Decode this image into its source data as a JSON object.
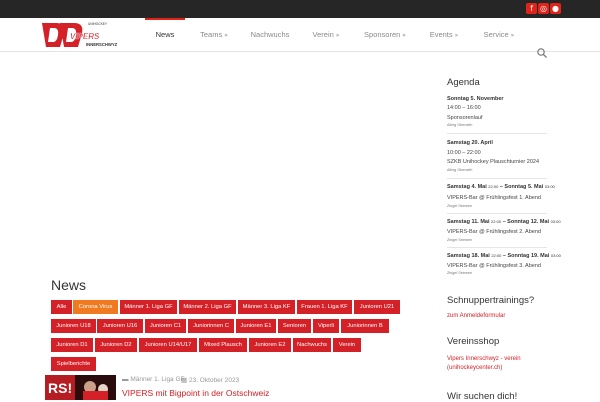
{
  "colors": {
    "accent": "#d42027",
    "highlight": "#f07a20",
    "topbar": "#262626"
  },
  "social": [
    "facebook-icon",
    "instagram-icon",
    "flickr-icon"
  ],
  "logo": {
    "name": "Unihockey Vipers Innerschwyz",
    "small_text": "UNIHOCKEY",
    "wordmark": "VIPERS",
    "subtitle": "INNERSCHWYZ"
  },
  "nav": [
    {
      "label": "News",
      "has_menu": false,
      "active": true
    },
    {
      "label": "Teams",
      "has_menu": true
    },
    {
      "label": "Nachwuchs",
      "has_menu": false
    },
    {
      "label": "Verein",
      "has_menu": true
    },
    {
      "label": "Sponsoren",
      "has_menu": true
    },
    {
      "label": "Events",
      "has_menu": true
    },
    {
      "label": "Service",
      "has_menu": true
    }
  ],
  "news": {
    "title": "News",
    "filters": [
      "Alle",
      "Corona Virus",
      "Männer 1. Liga GF",
      "Männer 2. Liga GF",
      "Männer 3. Liga KF",
      "Frauen 1. Liga KF",
      "Junioren U21",
      "Junioren U18",
      "Junioren U16",
      "Junioren C1",
      "Juniorinnen C",
      "Junioren E1",
      "Senioren",
      "Viperli",
      "Juniorinnen B",
      "Junioren D1",
      "Junioren D2",
      "Junioren U14/U17",
      "Mixed Plausch",
      "Junioren E2",
      "Nachwuchs",
      "Verein",
      "Spielberichte"
    ],
    "active_filter": "Corona Virus",
    "post": {
      "category": "Männer 1. Liga GF",
      "date": "23. Oktober 2023",
      "title": "VIPERS mit Bigpoint in der Ostschweiz",
      "thumb_text": "RS!"
    }
  },
  "agenda": {
    "title": "Agenda",
    "events": [
      {
        "date": "Sonntag 5. November",
        "date_end": "",
        "time": "14:00 – 16:00",
        "title": "Sponsorenlauf",
        "location": "Alling Oberarth"
      },
      {
        "date": "Samstag 20. April",
        "date_end": "",
        "time": "10:00 – 22:00",
        "title": "SZKB Unihockey Plauschturnier 2024",
        "location": "Alling Oberarth"
      },
      {
        "date": "Samstag 4. Mai",
        "date_time": "22:00",
        "date_end": "Sonntag 5. Mai",
        "date_end_time": "03:00",
        "time": "",
        "title": "VIPERS-Bar @ Frühlingsfest 1. Abend",
        "location": "Zingel Seewen"
      },
      {
        "date": "Samstag 11. Mai",
        "date_time": "22:00",
        "date_end": "Sonntag 12. Mai",
        "date_end_time": "03:00",
        "time": "",
        "title": "VIPERS-Bar @ Frühlingsfest 2. Abend",
        "location": "Zingel Seewen"
      },
      {
        "date": "Samstag 18. Mai",
        "date_time": "22:00",
        "date_end": "Sonntag 19. Mai",
        "date_end_time": "03:00",
        "time": "",
        "title": "VIPERS-Bar @ Frühlingsfest 3. Abend",
        "location": "Zingel Seewen"
      }
    ]
  },
  "schnupper": {
    "title": "Schnuppertrainings?",
    "link": "zum Anmeldeformular"
  },
  "shop": {
    "title": "Vereinsshop",
    "link_1": "Vipers Innerschwyz - verein",
    "link_2": "(unihockeycenter.ch)"
  },
  "wir_suchen": {
    "title": "Wir suchen dich!"
  }
}
